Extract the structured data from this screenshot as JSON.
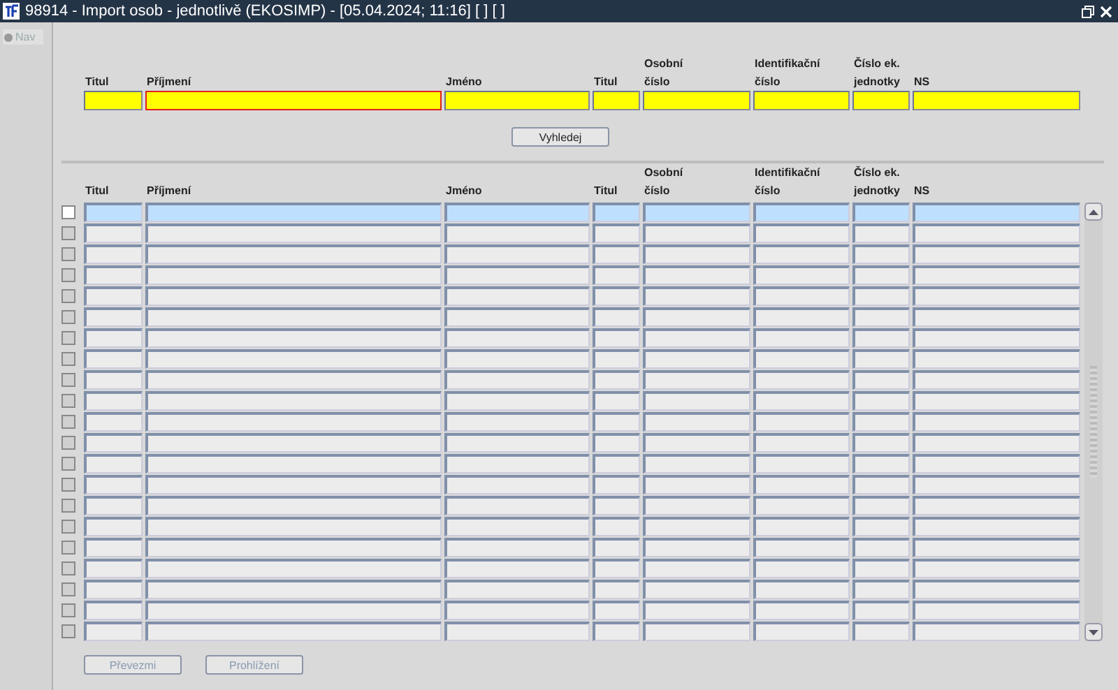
{
  "window": {
    "title": "98914 - Import osob - jednotlivě (EKOSIMP) - [05.04.2024; 11:16]  [ ]  [ ]"
  },
  "sidebar": {
    "items": [
      {
        "label": "Nav"
      }
    ]
  },
  "search": {
    "columns": [
      "Titul",
      "Příjmení",
      "Jméno",
      "Titul",
      "Osobní\nčíslo",
      "Identifikační\nčíslo",
      "Číslo ek.\njednotky",
      "NS"
    ],
    "fields": [
      {
        "focused": false
      },
      {
        "focused": true
      },
      {
        "focused": false
      },
      {
        "focused": false
      },
      {
        "focused": false
      },
      {
        "focused": false
      },
      {
        "focused": false
      },
      {
        "focused": false
      }
    ],
    "button": {
      "label": "Vyhledej",
      "disabled": false
    }
  },
  "table": {
    "columns": [
      "Titul",
      "Příjmení",
      "Jméno",
      "Titul",
      "Osobní\nčíslo",
      "Identifikační\nčíslo",
      "Číslo ek.\njednotky",
      "NS"
    ],
    "rows": [
      {
        "selected": true,
        "checked": false,
        "disabled": false
      },
      {
        "selected": false,
        "checked": false,
        "disabled": true
      },
      {
        "selected": false,
        "checked": false,
        "disabled": true
      },
      {
        "selected": false,
        "checked": false,
        "disabled": true
      },
      {
        "selected": false,
        "checked": false,
        "disabled": true
      },
      {
        "selected": false,
        "checked": false,
        "disabled": true
      },
      {
        "selected": false,
        "checked": false,
        "disabled": true
      },
      {
        "selected": false,
        "checked": false,
        "disabled": true
      },
      {
        "selected": false,
        "checked": false,
        "disabled": true
      },
      {
        "selected": false,
        "checked": false,
        "disabled": true
      },
      {
        "selected": false,
        "checked": false,
        "disabled": true
      },
      {
        "selected": false,
        "checked": false,
        "disabled": true
      },
      {
        "selected": false,
        "checked": false,
        "disabled": true
      },
      {
        "selected": false,
        "checked": false,
        "disabled": true
      },
      {
        "selected": false,
        "checked": false,
        "disabled": true
      },
      {
        "selected": false,
        "checked": false,
        "disabled": true
      },
      {
        "selected": false,
        "checked": false,
        "disabled": true
      },
      {
        "selected": false,
        "checked": false,
        "disabled": true
      },
      {
        "selected": false,
        "checked": false,
        "disabled": true
      },
      {
        "selected": false,
        "checked": false,
        "disabled": true
      },
      {
        "selected": false,
        "checked": false,
        "disabled": true
      }
    ]
  },
  "buttons": [
    {
      "label": "Převezmi",
      "disabled": true
    },
    {
      "label": "Prohlížení",
      "disabled": true
    }
  ]
}
